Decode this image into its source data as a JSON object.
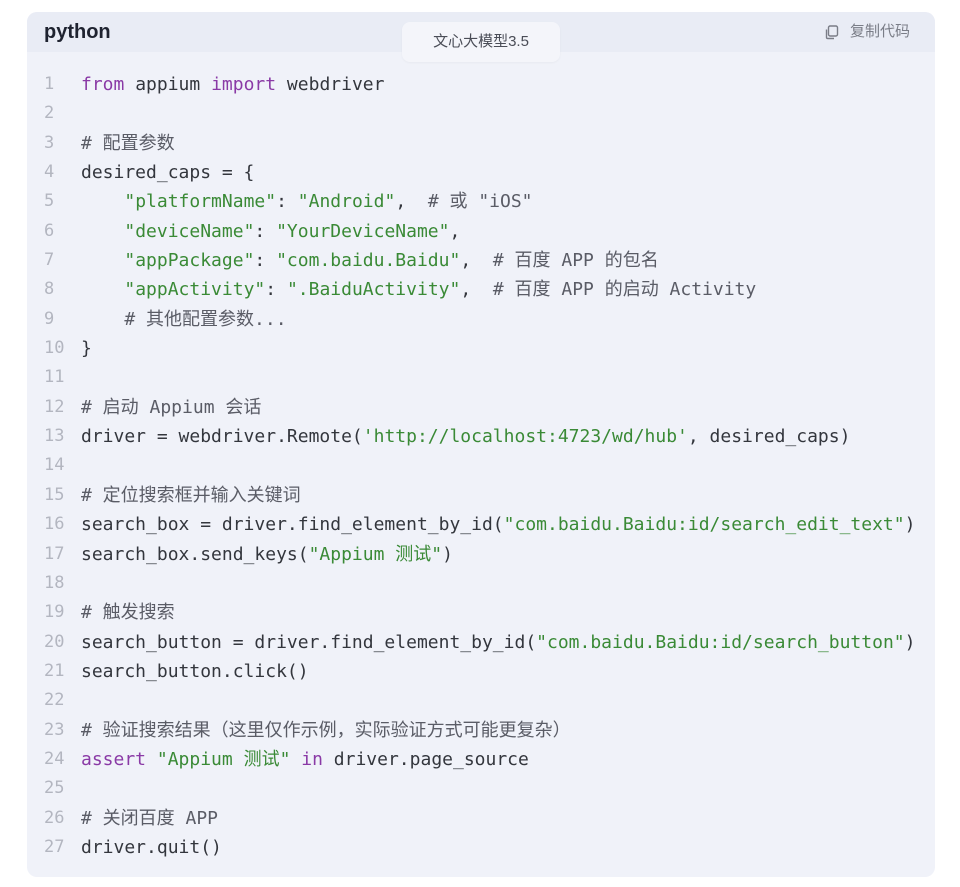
{
  "header": {
    "language": "python",
    "model_tag": "文心大模型3.5",
    "copy_label": "复制代码",
    "copy_icon": "copy-icon"
  },
  "colors": {
    "keyword": "#8a3aa6",
    "string": "#3a8a36",
    "comment": "#5a5c66",
    "text": "#33363d",
    "line_number": "#b3b6c0"
  },
  "code": {
    "lines": [
      {
        "number": 1,
        "tokens": [
          {
            "type": "keyword",
            "text": "from"
          },
          {
            "type": "text",
            "text": " appium "
          },
          {
            "type": "keyword",
            "text": "import"
          },
          {
            "type": "text",
            "text": " webdriver"
          }
        ]
      },
      {
        "number": 2,
        "tokens": []
      },
      {
        "number": 3,
        "tokens": [
          {
            "type": "comment",
            "text": "# 配置参数"
          }
        ]
      },
      {
        "number": 4,
        "tokens": [
          {
            "type": "text",
            "text": "desired_caps = {"
          }
        ]
      },
      {
        "number": 5,
        "tokens": [
          {
            "type": "text",
            "text": "    "
          },
          {
            "type": "string",
            "text": "\"platformName\""
          },
          {
            "type": "text",
            "text": ": "
          },
          {
            "type": "string",
            "text": "\"Android\""
          },
          {
            "type": "text",
            "text": ",  "
          },
          {
            "type": "comment",
            "text": "# 或 \"iOS\""
          }
        ]
      },
      {
        "number": 6,
        "tokens": [
          {
            "type": "text",
            "text": "    "
          },
          {
            "type": "string",
            "text": "\"deviceName\""
          },
          {
            "type": "text",
            "text": ": "
          },
          {
            "type": "string",
            "text": "\"YourDeviceName\""
          },
          {
            "type": "text",
            "text": ","
          }
        ]
      },
      {
        "number": 7,
        "tokens": [
          {
            "type": "text",
            "text": "    "
          },
          {
            "type": "string",
            "text": "\"appPackage\""
          },
          {
            "type": "text",
            "text": ": "
          },
          {
            "type": "string",
            "text": "\"com.baidu.Baidu\""
          },
          {
            "type": "text",
            "text": ",  "
          },
          {
            "type": "comment",
            "text": "# 百度 APP 的包名"
          }
        ]
      },
      {
        "number": 8,
        "tokens": [
          {
            "type": "text",
            "text": "    "
          },
          {
            "type": "string",
            "text": "\"appActivity\""
          },
          {
            "type": "text",
            "text": ": "
          },
          {
            "type": "string",
            "text": "\".BaiduActivity\""
          },
          {
            "type": "text",
            "text": ",  "
          },
          {
            "type": "comment",
            "text": "# 百度 APP 的启动 Activity"
          }
        ]
      },
      {
        "number": 9,
        "tokens": [
          {
            "type": "text",
            "text": "    "
          },
          {
            "type": "comment",
            "text": "# 其他配置参数..."
          }
        ]
      },
      {
        "number": 10,
        "tokens": [
          {
            "type": "text",
            "text": "}"
          }
        ]
      },
      {
        "number": 11,
        "tokens": []
      },
      {
        "number": 12,
        "tokens": [
          {
            "type": "comment",
            "text": "# 启动 Appium 会话"
          }
        ]
      },
      {
        "number": 13,
        "tokens": [
          {
            "type": "text",
            "text": "driver = webdriver.Remote("
          },
          {
            "type": "string",
            "text": "'http://localhost:4723/wd/hub'"
          },
          {
            "type": "text",
            "text": ", desired_caps)"
          }
        ]
      },
      {
        "number": 14,
        "tokens": []
      },
      {
        "number": 15,
        "tokens": [
          {
            "type": "comment",
            "text": "# 定位搜索框并输入关键词"
          }
        ]
      },
      {
        "number": 16,
        "tokens": [
          {
            "type": "text",
            "text": "search_box = driver.find_element_by_id("
          },
          {
            "type": "string",
            "text": "\"com.baidu.Baidu:id/search_edit_text\""
          },
          {
            "type": "text",
            "text": ")"
          }
        ]
      },
      {
        "number": 17,
        "tokens": [
          {
            "type": "text",
            "text": "search_box.send_keys("
          },
          {
            "type": "string",
            "text": "\"Appium 测试\""
          },
          {
            "type": "text",
            "text": ")"
          }
        ]
      },
      {
        "number": 18,
        "tokens": []
      },
      {
        "number": 19,
        "tokens": [
          {
            "type": "comment",
            "text": "# 触发搜索"
          }
        ]
      },
      {
        "number": 20,
        "tokens": [
          {
            "type": "text",
            "text": "search_button = driver.find_element_by_id("
          },
          {
            "type": "string",
            "text": "\"com.baidu.Baidu:id/search_button\""
          },
          {
            "type": "text",
            "text": ")"
          }
        ]
      },
      {
        "number": 21,
        "tokens": [
          {
            "type": "text",
            "text": "search_button.click()"
          }
        ]
      },
      {
        "number": 22,
        "tokens": []
      },
      {
        "number": 23,
        "tokens": [
          {
            "type": "comment",
            "text": "# 验证搜索结果（这里仅作示例，实际验证方式可能更复杂）"
          }
        ]
      },
      {
        "number": 24,
        "tokens": [
          {
            "type": "keyword",
            "text": "assert"
          },
          {
            "type": "text",
            "text": " "
          },
          {
            "type": "string",
            "text": "\"Appium 测试\""
          },
          {
            "type": "text",
            "text": " "
          },
          {
            "type": "keyword",
            "text": "in"
          },
          {
            "type": "text",
            "text": " driver.page_source"
          }
        ]
      },
      {
        "number": 25,
        "tokens": []
      },
      {
        "number": 26,
        "tokens": [
          {
            "type": "comment",
            "text": "# 关闭百度 APP"
          }
        ]
      },
      {
        "number": 27,
        "tokens": [
          {
            "type": "text",
            "text": "driver.quit()"
          }
        ]
      }
    ]
  }
}
